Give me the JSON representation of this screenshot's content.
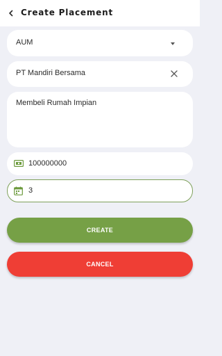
{
  "header": {
    "title": "Create Placement",
    "back_icon": "back-arrow-icon"
  },
  "form": {
    "product_select": {
      "value": "AUM",
      "icon": "chevron-down-icon"
    },
    "partner_field": {
      "value": "PT Mandiri Bersama",
      "icon": "close-icon"
    },
    "purpose_field": {
      "value": "Membeli Rumah Impian"
    },
    "amount_field": {
      "value": "100000000",
      "icon": "money-icon"
    },
    "tenor_field": {
      "value": "3",
      "icon": "calendar-icon"
    }
  },
  "actions": {
    "create_label": "CREATE",
    "cancel_label": "CANCEL"
  },
  "colors": {
    "accent": "#76a046",
    "danger": "#ef3e35",
    "background": "#eff0f6"
  }
}
